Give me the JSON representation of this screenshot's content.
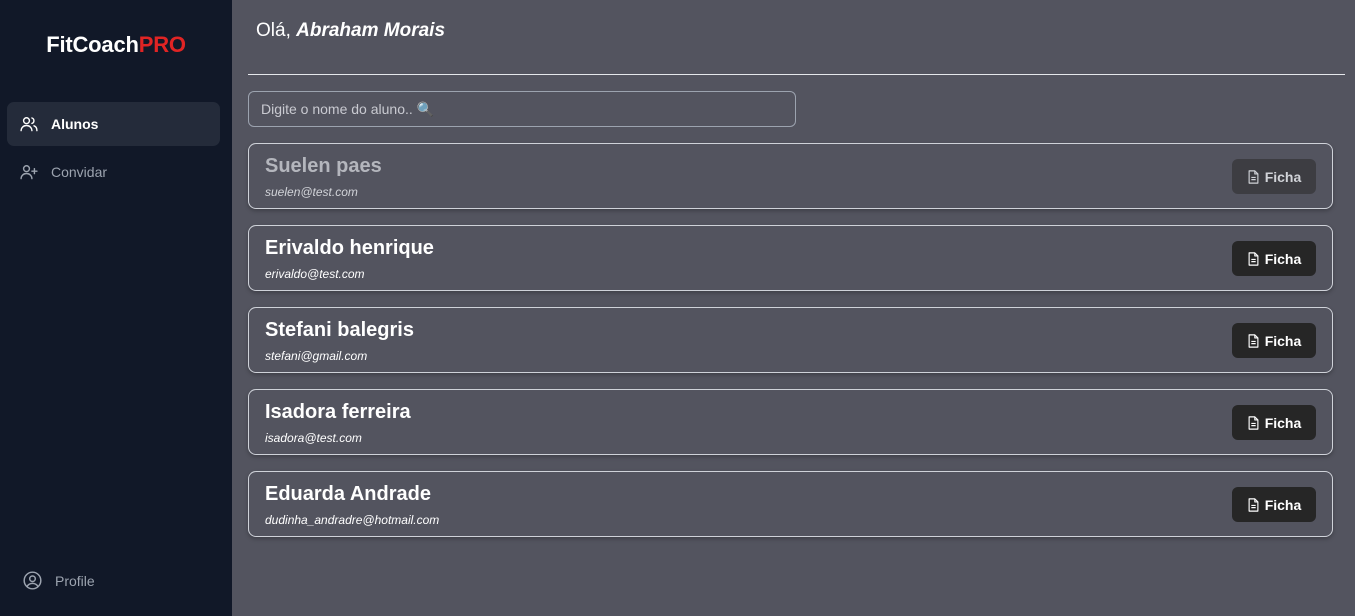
{
  "sidebar": {
    "brand_main": "FitCoach",
    "brand_accent": "PRO",
    "brand_accent_color": "#e02424",
    "items": [
      {
        "label": "Alunos",
        "icon": "users-icon",
        "active": true
      },
      {
        "label": "Convidar",
        "icon": "user-plus-icon",
        "active": false
      }
    ],
    "profile_label": "Profile",
    "profile_icon": "user-circle-icon"
  },
  "header": {
    "greeting": "Olá,",
    "user_name": "Abraham Morais"
  },
  "search": {
    "placeholder": "Digite o nome do aluno.. 🔍"
  },
  "students": [
    {
      "name": "Suelen paes",
      "email": "suelen@test.com",
      "action": "Ficha"
    },
    {
      "name": "Erivaldo henrique",
      "email": "erivaldo@test.com",
      "action": "Ficha"
    },
    {
      "name": "Stefani balegris",
      "email": "stefani@gmail.com",
      "action": "Ficha"
    },
    {
      "name": "Isadora ferreira",
      "email": "isadora@test.com",
      "action": "Ficha"
    },
    {
      "name": "Eduarda Andrade",
      "email": "dudinha_andradre@hotmail.com",
      "action": "Ficha"
    }
  ]
}
